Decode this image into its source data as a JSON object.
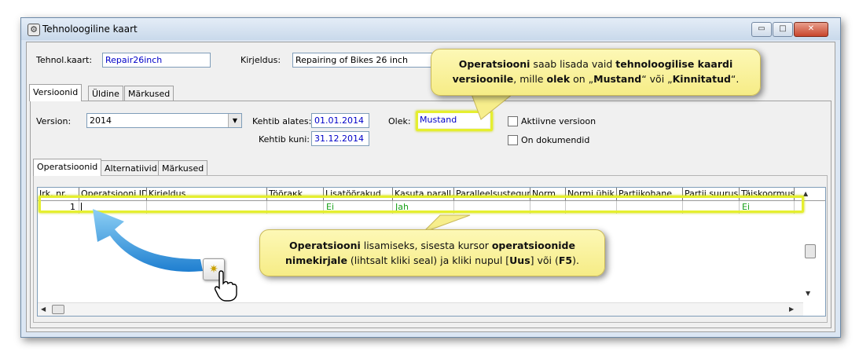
{
  "window": {
    "title": "Tehnoloogiline kaart",
    "buttons": {
      "minimize": "▭",
      "maximize": "□",
      "close": "✕"
    }
  },
  "header": {
    "kaart_label": "Tehnol.kaart:",
    "kaart_value": "Repair26inch",
    "kirjeldus_label": "Kirjeldus:",
    "kirjeldus_value": "Repairing of Bikes 26 inch"
  },
  "main_tabs": [
    "Versioonid",
    "Üldine",
    "Märkused"
  ],
  "version": {
    "version_label": "Version:",
    "version_value": "2014",
    "kehtib_alates_label": "Kehtib alates:",
    "kehtib_alates_value": "01.01.2014",
    "kehtib_kuni_label": "Kehtib kuni:",
    "kehtib_kuni_value": "31.12.2014",
    "olek_label": "Olek:",
    "olek_value": "Mustand",
    "aktiivne_label": "Aktiivne versioon",
    "dokumendid_label": "On dokumendid"
  },
  "sub_tabs": [
    "Operatsioonid",
    "Alternatiivid",
    "Märkused"
  ],
  "grid": {
    "columns": [
      "Jrk. nr.",
      "Operatsiooni ID",
      "Kirjeldus",
      "Tööraкk",
      "Lisatöörakud",
      "Kasuta parall.",
      "Paralleelsustegur",
      "Norm",
      "Normi ühik",
      "Partiikohane",
      "Partii suurus",
      "Täiskoormus"
    ],
    "rows": [
      [
        "1",
        "",
        "",
        "",
        "Ei",
        "Jah",
        "",
        "",
        "",
        "",
        "",
        "Ei"
      ]
    ]
  },
  "callout_top": {
    "p1": "Operatsiooni",
    "p2": " saab lisada vaid ",
    "p3": "tehnoloogilise kaardi",
    "p4": "versioonile",
    "p5": ", mille ",
    "p6": "olek",
    "p7": " on „",
    "p8": "Mustand",
    "p9": "“ või „",
    "p10": "Kinnitatud",
    "p11": "“."
  },
  "callout_bottom": {
    "p1": "Operatsiooni",
    "p2": " lisamiseks, sisesta kursor ",
    "p3": "operatsioonide",
    "p4": "nimekirjale",
    "p5": " (lihtsalt kliki seal) ja kliki nupul [",
    "p6": "Uus",
    "p7": "] või (",
    "p8": "F5",
    "p9": ")."
  },
  "colors": {
    "highlight": "#e5ef2f",
    "callout_bg": "#fbf4a4",
    "field_text": "#0000c8",
    "grid_value": "#18a018",
    "arrow": "#3a9ee0"
  }
}
